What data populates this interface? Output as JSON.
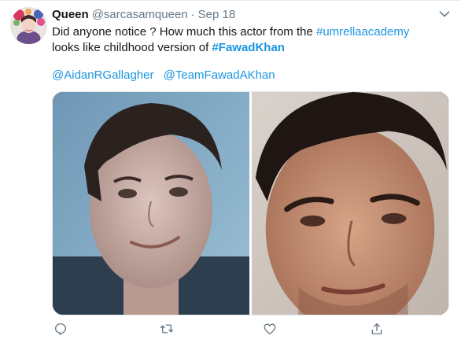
{
  "tweet": {
    "author_name": "Queen",
    "author_handle": "@sarcasamqueen",
    "separator": "·",
    "date": "Sep 18",
    "line1_prefix": "Did anyone notice ? How much this actor from the ",
    "line1_hashtag": "#umrellaacademy",
    "line2_prefix": "looks like childhood version of ",
    "line2_hashtag": "#FawadKhan",
    "mentions": [
      "@AidanRGallagher",
      "@TeamFawadAKhan"
    ]
  },
  "colors": {
    "link": "#1b95e0",
    "muted": "#657786",
    "text": "#14171a",
    "icon": "#657786"
  },
  "icons": {
    "reply": "speech-bubble",
    "retweet": "two-arrows-loop",
    "like": "heart-outline",
    "share": "upload-arrow",
    "menu": "chevron-down"
  }
}
